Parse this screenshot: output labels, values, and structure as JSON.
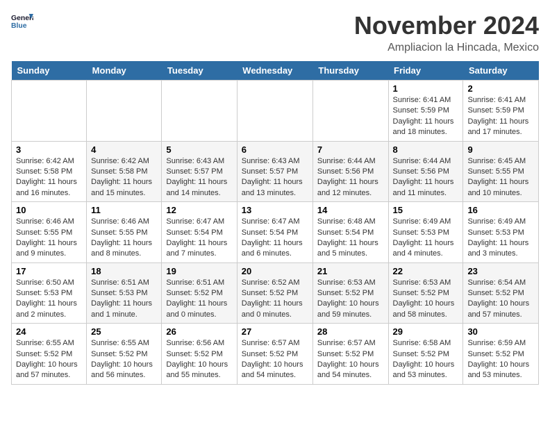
{
  "logo": {
    "text_general": "General",
    "text_blue": "Blue"
  },
  "header": {
    "month": "November 2024",
    "location": "Ampliacion la Hincada, Mexico"
  },
  "weekdays": [
    "Sunday",
    "Monday",
    "Tuesday",
    "Wednesday",
    "Thursday",
    "Friday",
    "Saturday"
  ],
  "weeks": [
    [
      {
        "day": "",
        "info": ""
      },
      {
        "day": "",
        "info": ""
      },
      {
        "day": "",
        "info": ""
      },
      {
        "day": "",
        "info": ""
      },
      {
        "day": "",
        "info": ""
      },
      {
        "day": "1",
        "info": "Sunrise: 6:41 AM\nSunset: 5:59 PM\nDaylight: 11 hours\nand 18 minutes."
      },
      {
        "day": "2",
        "info": "Sunrise: 6:41 AM\nSunset: 5:59 PM\nDaylight: 11 hours\nand 17 minutes."
      }
    ],
    [
      {
        "day": "3",
        "info": "Sunrise: 6:42 AM\nSunset: 5:58 PM\nDaylight: 11 hours\nand 16 minutes."
      },
      {
        "day": "4",
        "info": "Sunrise: 6:42 AM\nSunset: 5:58 PM\nDaylight: 11 hours\nand 15 minutes."
      },
      {
        "day": "5",
        "info": "Sunrise: 6:43 AM\nSunset: 5:57 PM\nDaylight: 11 hours\nand 14 minutes."
      },
      {
        "day": "6",
        "info": "Sunrise: 6:43 AM\nSunset: 5:57 PM\nDaylight: 11 hours\nand 13 minutes."
      },
      {
        "day": "7",
        "info": "Sunrise: 6:44 AM\nSunset: 5:56 PM\nDaylight: 11 hours\nand 12 minutes."
      },
      {
        "day": "8",
        "info": "Sunrise: 6:44 AM\nSunset: 5:56 PM\nDaylight: 11 hours\nand 11 minutes."
      },
      {
        "day": "9",
        "info": "Sunrise: 6:45 AM\nSunset: 5:55 PM\nDaylight: 11 hours\nand 10 minutes."
      }
    ],
    [
      {
        "day": "10",
        "info": "Sunrise: 6:46 AM\nSunset: 5:55 PM\nDaylight: 11 hours\nand 9 minutes."
      },
      {
        "day": "11",
        "info": "Sunrise: 6:46 AM\nSunset: 5:55 PM\nDaylight: 11 hours\nand 8 minutes."
      },
      {
        "day": "12",
        "info": "Sunrise: 6:47 AM\nSunset: 5:54 PM\nDaylight: 11 hours\nand 7 minutes."
      },
      {
        "day": "13",
        "info": "Sunrise: 6:47 AM\nSunset: 5:54 PM\nDaylight: 11 hours\nand 6 minutes."
      },
      {
        "day": "14",
        "info": "Sunrise: 6:48 AM\nSunset: 5:54 PM\nDaylight: 11 hours\nand 5 minutes."
      },
      {
        "day": "15",
        "info": "Sunrise: 6:49 AM\nSunset: 5:53 PM\nDaylight: 11 hours\nand 4 minutes."
      },
      {
        "day": "16",
        "info": "Sunrise: 6:49 AM\nSunset: 5:53 PM\nDaylight: 11 hours\nand 3 minutes."
      }
    ],
    [
      {
        "day": "17",
        "info": "Sunrise: 6:50 AM\nSunset: 5:53 PM\nDaylight: 11 hours\nand 2 minutes."
      },
      {
        "day": "18",
        "info": "Sunrise: 6:51 AM\nSunset: 5:53 PM\nDaylight: 11 hours\nand 1 minute."
      },
      {
        "day": "19",
        "info": "Sunrise: 6:51 AM\nSunset: 5:52 PM\nDaylight: 11 hours\nand 0 minutes."
      },
      {
        "day": "20",
        "info": "Sunrise: 6:52 AM\nSunset: 5:52 PM\nDaylight: 11 hours\nand 0 minutes."
      },
      {
        "day": "21",
        "info": "Sunrise: 6:53 AM\nSunset: 5:52 PM\nDaylight: 10 hours\nand 59 minutes."
      },
      {
        "day": "22",
        "info": "Sunrise: 6:53 AM\nSunset: 5:52 PM\nDaylight: 10 hours\nand 58 minutes."
      },
      {
        "day": "23",
        "info": "Sunrise: 6:54 AM\nSunset: 5:52 PM\nDaylight: 10 hours\nand 57 minutes."
      }
    ],
    [
      {
        "day": "24",
        "info": "Sunrise: 6:55 AM\nSunset: 5:52 PM\nDaylight: 10 hours\nand 57 minutes."
      },
      {
        "day": "25",
        "info": "Sunrise: 6:55 AM\nSunset: 5:52 PM\nDaylight: 10 hours\nand 56 minutes."
      },
      {
        "day": "26",
        "info": "Sunrise: 6:56 AM\nSunset: 5:52 PM\nDaylight: 10 hours\nand 55 minutes."
      },
      {
        "day": "27",
        "info": "Sunrise: 6:57 AM\nSunset: 5:52 PM\nDaylight: 10 hours\nand 54 minutes."
      },
      {
        "day": "28",
        "info": "Sunrise: 6:57 AM\nSunset: 5:52 PM\nDaylight: 10 hours\nand 54 minutes."
      },
      {
        "day": "29",
        "info": "Sunrise: 6:58 AM\nSunset: 5:52 PM\nDaylight: 10 hours\nand 53 minutes."
      },
      {
        "day": "30",
        "info": "Sunrise: 6:59 AM\nSunset: 5:52 PM\nDaylight: 10 hours\nand 53 minutes."
      }
    ]
  ]
}
